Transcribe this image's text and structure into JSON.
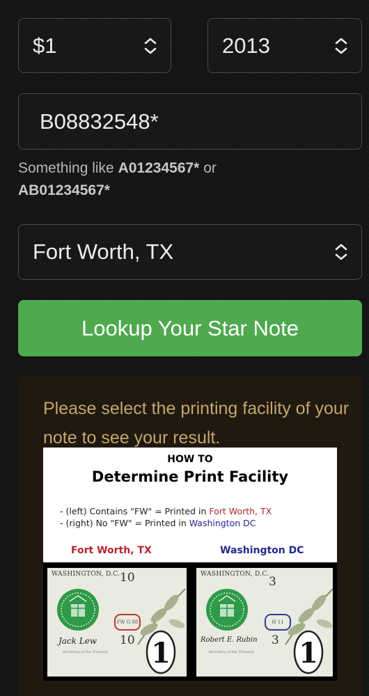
{
  "form": {
    "denomination": "$1",
    "year": "2013",
    "serial_value": "B08832548*",
    "hint_prefix": "Something like ",
    "hint_example1": "A01234567*",
    "hint_or": " or ",
    "hint_example2": "AB01234567*",
    "location": "Fort Worth, TX",
    "lookup_label": "Lookup Your Star Note"
  },
  "result": {
    "message": "Please select the printing facility of your note to see your result."
  },
  "howto": {
    "title_small": "HOW TO",
    "title_large": "Determine Print Facility",
    "line1_prefix": "- (left) Contains \"FW\" = Printed in ",
    "line1_place": "Fort Worth, TX",
    "line2_prefix": "- (right) No \"FW\" = Printed in ",
    "line2_place": "Washington DC",
    "left_label": "Fort Worth, TX",
    "right_label": "Washington DC",
    "left_note": {
      "header": "WASHINGTON, D.C.",
      "number": "10",
      "plate": "FW G 88",
      "signature": "Jack Lew",
      "sig_title": "Secretary of the Treasury"
    },
    "right_note": {
      "header": "WASHINGTON, D.C.",
      "number": "3",
      "plate": "H 11",
      "signature": "Robert E. Rubin",
      "sig_title": "Secretary of the Treasury"
    }
  },
  "colors": {
    "accent_green": "#4ea94f",
    "message_gold": "#c4a66d",
    "fort_worth_red": "#b3262c",
    "washington_blue": "#23288a"
  },
  "icons": {
    "select_chevron": "chevron-up-down-icon"
  }
}
